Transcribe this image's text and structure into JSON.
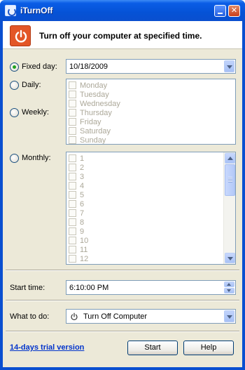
{
  "window": {
    "title": "iTurnOff"
  },
  "header": {
    "text": "Turn off your computer at specified time."
  },
  "schedule": {
    "fixed_day_label": "Fixed day:",
    "fixed_day_value": "10/18/2009",
    "daily_label": "Daily:",
    "weekly_label": "Weekly:",
    "monthly_label": "Monthly:",
    "selected_mode": "fixed_day",
    "weekdays": [
      "Monday",
      "Tuesday",
      "Wednesday",
      "Thursday",
      "Friday",
      "Saturday",
      "Sunday"
    ],
    "month_days": [
      "1",
      "2",
      "3",
      "4",
      "5",
      "6",
      "7",
      "8",
      "9",
      "10",
      "11",
      "12"
    ]
  },
  "start_time": {
    "label": "Start time:",
    "value": "6:10:00 PM"
  },
  "action": {
    "label": "What to do:",
    "value": "Turn Off Computer"
  },
  "footer": {
    "trial_link": "14-days trial version",
    "start_label": "Start",
    "help_label": "Help"
  },
  "colors": {
    "titlebar": "#0552d6",
    "client_bg": "#ece9d8",
    "accent_orange": "#e35627",
    "link": "#0033cc"
  }
}
